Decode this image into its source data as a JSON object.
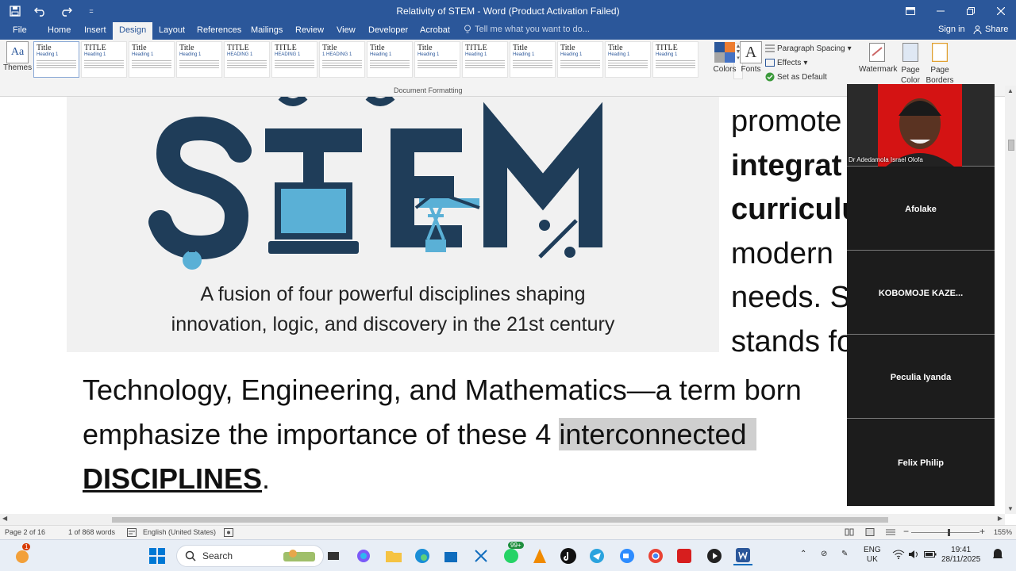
{
  "window": {
    "title": "Relativity of STEM - Word (Product Activation Failed)",
    "qat_customize": "="
  },
  "tabs": [
    {
      "label": "File"
    },
    {
      "label": "Home"
    },
    {
      "label": "Insert"
    },
    {
      "label": "Design"
    },
    {
      "label": "Layout"
    },
    {
      "label": "References"
    },
    {
      "label": "Mailings"
    },
    {
      "label": "Review"
    },
    {
      "label": "View"
    },
    {
      "label": "Developer"
    },
    {
      "label": "Acrobat"
    }
  ],
  "active_tab": "Design",
  "tell_me": "Tell me what you want to do...",
  "account": {
    "sign_in": "Sign in",
    "share": "Share"
  },
  "ribbon": {
    "themes_label": "Themes",
    "group_label": "Document Formatting",
    "styles": [
      {
        "title": "Title",
        "heading": "Heading 1"
      },
      {
        "title": "TITLE",
        "heading": "Heading 1"
      },
      {
        "title": "Title",
        "heading": "Heading 1"
      },
      {
        "title": "Title",
        "heading": "Heading 1"
      },
      {
        "title": "TITLE",
        "heading": "HEADING 1"
      },
      {
        "title": "TITLE",
        "heading": "HEADING 1"
      },
      {
        "title": "Title",
        "heading": "1 HEADING 1"
      },
      {
        "title": "Title",
        "heading": "Heading 1"
      },
      {
        "title": "Title",
        "heading": "Heading 1"
      },
      {
        "title": "TITLE",
        "heading": "Heading 1"
      },
      {
        "title": "Title",
        "heading": "Heading 1"
      },
      {
        "title": "Title",
        "heading": "Heading 1"
      },
      {
        "title": "Title",
        "heading": "Heading 1"
      },
      {
        "title": "TITLE",
        "heading": "Heading 1"
      }
    ],
    "colors_label": "Colors",
    "fonts_label": "Fonts",
    "paragraph_spacing": "Paragraph Spacing",
    "effects": "Effects",
    "set_default": "Set as Default",
    "watermark": "Watermark",
    "page_color": "Page Color",
    "page_borders": "Page Borders"
  },
  "figure": {
    "caption_line1": "A fusion of four powerful disciplines shaping",
    "caption_line2": "innovation, logic, and discovery in the 21st century"
  },
  "document": {
    "line1": "Technology, Engineering, and Mathematics—a term born",
    "line2_prefix": "emphasize the importance of these 4 ",
    "line2_highlight": "interconnected",
    "line3_bold": "DISCIPLINES",
    "line3_end": ".",
    "side_lines": [
      "promote",
      "integrat",
      "curriculu",
      "modern",
      "needs. ST",
      "stands fo"
    ]
  },
  "meeting": {
    "participants": [
      {
        "name": "Dr Adedamola Israel Olofa",
        "video": true
      },
      {
        "name": "Afolake"
      },
      {
        "name": "KOBOMOJE  KAZE..."
      },
      {
        "name": "Peculia Iyanda"
      },
      {
        "name": "Felix Philip"
      }
    ]
  },
  "status": {
    "page": "Page 2 of 16",
    "words": "1 of 868 words",
    "language": "English (United States)",
    "zoom": "155%",
    "zoom_fraction": 0.55
  },
  "taskbar": {
    "search_label": "Search",
    "notification_badge": "1",
    "whatsapp_badge": "99+",
    "language_line1": "ENG",
    "language_line2": "UK",
    "time": "19:41",
    "date": "28/11/2025"
  },
  "colors": {
    "word_blue": "#2b579a",
    "stem_navy": "#1f3d59",
    "stem_lightblue": "#5ab0d6",
    "video_red": "#d41313"
  }
}
